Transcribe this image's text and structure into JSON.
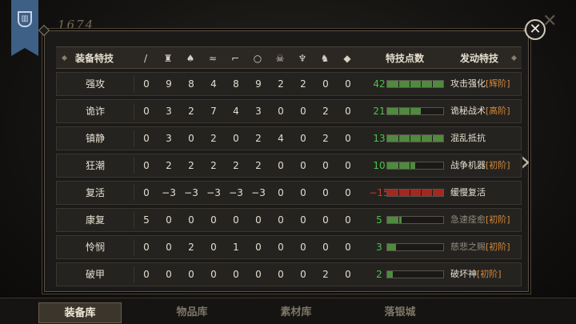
{
  "header_score": "1674",
  "table": {
    "col_name": "装备特技",
    "col_points": "特技点数",
    "col_skill": "发动特技",
    "stat_icons": [
      "sword-icon",
      "helmet-icon",
      "armor-icon",
      "wing-icon",
      "boot-icon",
      "ring-icon",
      "skull-icon",
      "demon-mask-icon",
      "horse-icon",
      "gem-icon"
    ]
  },
  "rows": [
    {
      "name": "强攻",
      "values": [
        "0",
        "9",
        "8",
        "4",
        "8",
        "9",
        "2",
        "2",
        "0",
        "0"
      ],
      "points": "42",
      "fill": 1.0,
      "skill": "攻击强化",
      "tag": "[辉阶]",
      "negative": false,
      "dim": false
    },
    {
      "name": "诡诈",
      "values": [
        "0",
        "3",
        "2",
        "7",
        "4",
        "3",
        "0",
        "0",
        "2",
        "0"
      ],
      "points": "21",
      "fill": 0.6,
      "skill": "诡秘战术",
      "tag": "[高阶]",
      "negative": false,
      "dim": false
    },
    {
      "name": "镇静",
      "values": [
        "0",
        "3",
        "0",
        "2",
        "0",
        "2",
        "4",
        "0",
        "2",
        "0"
      ],
      "points": "13",
      "fill": 1.0,
      "skill": "混乱抵抗",
      "tag": "",
      "negative": false,
      "dim": false
    },
    {
      "name": "狂潮",
      "values": [
        "0",
        "2",
        "2",
        "2",
        "2",
        "2",
        "0",
        "0",
        "0",
        "0"
      ],
      "points": "10",
      "fill": 0.5,
      "skill": "战争机器",
      "tag": "[初阶]",
      "negative": false,
      "dim": false
    },
    {
      "name": "复活",
      "values": [
        "0",
        "−3",
        "−3",
        "−3",
        "−3",
        "−3",
        "0",
        "0",
        "0",
        "0"
      ],
      "points": "−15",
      "fill": 1.0,
      "skill": "缓慢复活",
      "tag": "",
      "negative": true,
      "dim": false
    },
    {
      "name": "康复",
      "values": [
        "5",
        "0",
        "0",
        "0",
        "0",
        "0",
        "0",
        "0",
        "0",
        "0"
      ],
      "points": "5",
      "fill": 0.25,
      "skill": "急速痊愈",
      "tag": "[初阶]",
      "negative": false,
      "dim": true
    },
    {
      "name": "怜悯",
      "values": [
        "0",
        "0",
        "2",
        "0",
        "1",
        "0",
        "0",
        "0",
        "0",
        "0"
      ],
      "points": "3",
      "fill": 0.15,
      "skill": "慈悲之赐",
      "tag": "[初阶]",
      "negative": false,
      "dim": true
    },
    {
      "name": "破甲",
      "values": [
        "0",
        "0",
        "0",
        "0",
        "0",
        "0",
        "0",
        "0",
        "2",
        "0"
      ],
      "points": "2",
      "fill": 0.1,
      "skill": "破坏神",
      "tag": "[初阶]",
      "negative": false,
      "dim": false
    }
  ],
  "tabs": [
    {
      "label": "装备库",
      "active": true
    },
    {
      "label": "物品库",
      "active": false
    },
    {
      "label": "素材库",
      "active": false
    },
    {
      "label": "落银城",
      "active": false
    }
  ],
  "colors": {
    "positive": "#4cc24a",
    "negative": "#d3362c",
    "tag": "#d48a3c"
  }
}
